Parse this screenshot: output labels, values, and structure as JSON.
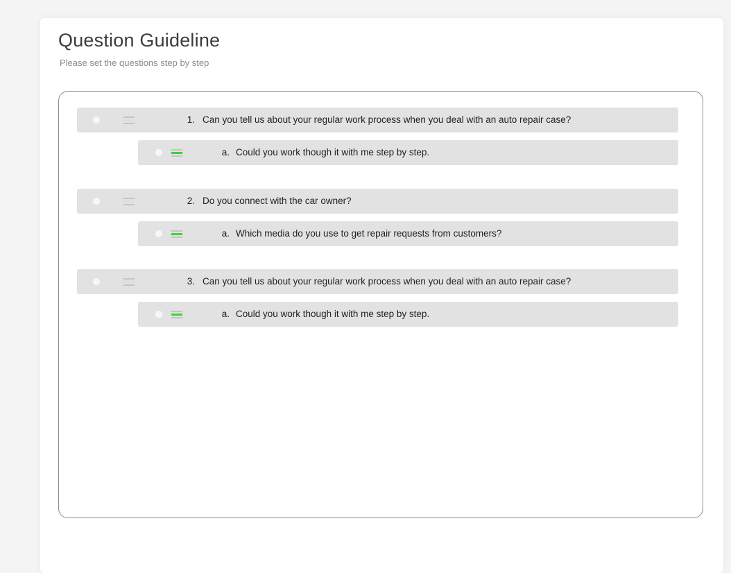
{
  "header": {
    "title": "Question Guideline",
    "subtitle": "Please set the questions step by step"
  },
  "colors": {
    "handle_accent": "#39d439",
    "row_bg": "#e2e2e2",
    "border": "#8c8c8c"
  },
  "questions": [
    {
      "number": "1.",
      "text": "Can you tell us about your regular work process when you deal with an auto repair case?",
      "sub": {
        "number": "a.",
        "text": "Could you work though it with me step by step."
      }
    },
    {
      "number": "2.",
      "text": "Do you connect with the car owner?",
      "sub": {
        "number": "a.",
        "text": "Which media do you use to get repair requests from customers?"
      }
    },
    {
      "number": "3.",
      "text": "Can you tell us about your regular work process when you deal with an auto repair case?",
      "sub": {
        "number": "a.",
        "text": "Could you work though it with me step by step."
      }
    }
  ]
}
